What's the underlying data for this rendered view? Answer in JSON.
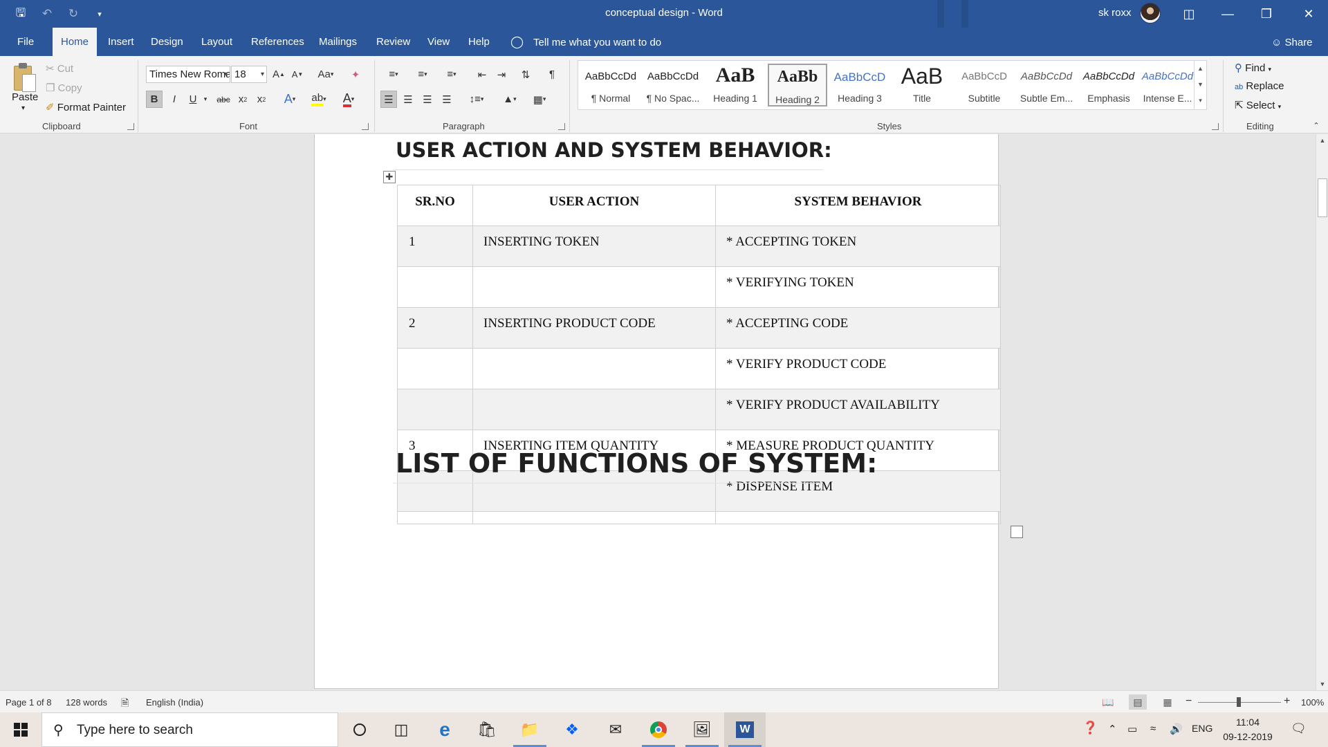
{
  "window": {
    "title": "conceptual design  -  Word",
    "user": "sk roxx"
  },
  "tabs": [
    {
      "label": "File"
    },
    {
      "label": "Home"
    },
    {
      "label": "Insert"
    },
    {
      "label": "Design"
    },
    {
      "label": "Layout"
    },
    {
      "label": "References"
    },
    {
      "label": "Mailings"
    },
    {
      "label": "Review"
    },
    {
      "label": "View"
    },
    {
      "label": "Help"
    }
  ],
  "tell_me": "Tell me what you want to do",
  "share_label": "Share",
  "clipboard": {
    "paste": "Paste",
    "cut": "Cut",
    "copy": "Copy",
    "format_painter": "Format Painter",
    "group": "Clipboard"
  },
  "font": {
    "name": "Times New Roman",
    "size": "18",
    "change_case": "Aa",
    "group": "Font"
  },
  "paragraph": {
    "group": "Paragraph"
  },
  "styles": {
    "group": "Styles",
    "items": [
      {
        "sample": "AaBbCcDd",
        "name": "¶ Normal"
      },
      {
        "sample": "AaBbCcDd",
        "name": "¶ No Spac..."
      },
      {
        "sample": "AaB",
        "name": "Heading 1"
      },
      {
        "sample": "AaBb",
        "name": "Heading 2"
      },
      {
        "sample": "AaBbCcD",
        "name": "Heading 3"
      },
      {
        "sample": "AaB",
        "name": "Title"
      },
      {
        "sample": "AaBbCcD",
        "name": "Subtitle"
      },
      {
        "sample": "AaBbCcDd",
        "name": "Subtle Em..."
      },
      {
        "sample": "AaBbCcDd",
        "name": "Emphasis"
      },
      {
        "sample": "AaBbCcDd",
        "name": "Intense E..."
      }
    ]
  },
  "editing": {
    "find": "Find",
    "replace": "Replace",
    "select": "Select",
    "group": "Editing"
  },
  "document": {
    "heading1": "USER ACTION AND SYSTEM BEHAVIOR:",
    "heading2": "LIST OF FUNCTIONS OF SYSTEM:",
    "table": {
      "headers": [
        "SR.NO",
        "USER ACTION",
        "SYSTEM BEHAVIOR"
      ],
      "rows": [
        [
          "1",
          "INSERTING TOKEN",
          "* ACCEPTING TOKEN"
        ],
        [
          "",
          "",
          "* VERIFYING TOKEN"
        ],
        [
          "2",
          "INSERTING PRODUCT CODE",
          "* ACCEPTING CODE"
        ],
        [
          "",
          "",
          "* VERIFY PRODUCT CODE"
        ],
        [
          "",
          "",
          "* VERIFY PRODUCT AVAILABILITY"
        ],
        [
          "3",
          "INSERTING ITEM QUANTITY",
          "* MEASURE PRODUCT QUANTITY"
        ],
        [
          "",
          "",
          "* DISPENSE ITEM"
        ]
      ]
    }
  },
  "statusbar": {
    "page": "Page 1 of 8",
    "words": "128 words",
    "language": "English (India)",
    "zoom": "100%",
    "zoom_level": 1.0
  },
  "taskbar": {
    "search_placeholder": "Type here to search",
    "language": "ENG",
    "time": "11:04",
    "date": "09-12-2019"
  },
  "colors": {
    "word_blue": "#2b579a",
    "ribbon_bg": "#f3f3f3",
    "font_color_red": "#d13438",
    "highlight_yellow": "#ffff00"
  }
}
